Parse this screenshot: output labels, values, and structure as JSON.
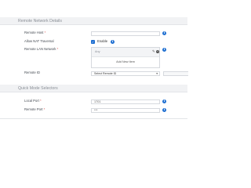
{
  "sections": {
    "remote_network": {
      "title": "Remote Network Details"
    },
    "quick_mode": {
      "title": "Quick Mode Selectors"
    }
  },
  "fields": {
    "remote_host": {
      "label": "Remote Host",
      "required_mark": "*",
      "value": ""
    },
    "allow_nat": {
      "label": "Allow NAT Traversal",
      "checkbox_label": "Enable",
      "checked": true
    },
    "remote_lan": {
      "label": "Remote LAN Network",
      "required_mark": "*",
      "rows": [
        "Any"
      ],
      "add_label": "Add New Item"
    },
    "remote_id": {
      "label": "Remote ID",
      "selected": "Select Remote ID"
    },
    "local_port": {
      "label": "Local Port",
      "required_mark": "*",
      "value": "1701"
    },
    "remote_port": {
      "label": "Remote Port",
      "required_mark": "*",
      "value": "***"
    }
  },
  "icons": {
    "info": "info-icon",
    "edit": "pencil-icon",
    "remove": "minus-circle-icon",
    "checkbox": "checkmark-icon",
    "dropdown": "chevron-down-icon"
  },
  "colors": {
    "accent": "#1f6fd1",
    "header_bg": "#f1f2f4",
    "required": "#d9534f"
  }
}
